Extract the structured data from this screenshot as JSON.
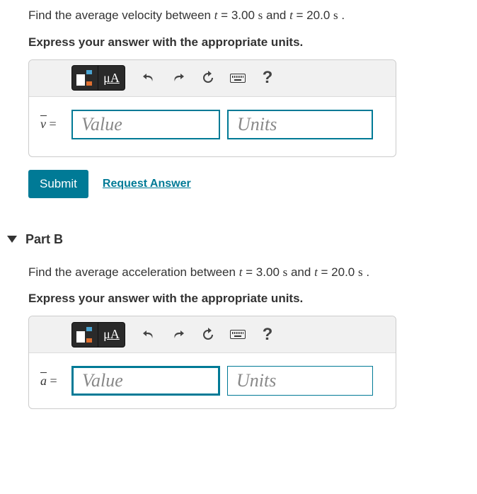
{
  "partA": {
    "prompt_prefix": "Find the average velocity between ",
    "t1_var": "t",
    "t1_eq": " = 3.00 ",
    "t1_unit": "s",
    "mid": " and ",
    "t2_var": "t",
    "t2_eq": " = 20.0 ",
    "t2_unit": "s",
    "suffix": " .",
    "instruction": "Express your answer with the appropriate units.",
    "var_v": "v",
    "var_eq": " = ",
    "value_placeholder": "Value",
    "units_placeholder": "Units",
    "mua_label": "μA",
    "help_label": "?",
    "submit_label": "Submit",
    "request_label": "Request Answer"
  },
  "partB": {
    "title": "Part B",
    "prompt_prefix": "Find the average acceleration between ",
    "t1_var": "t",
    "t1_eq": " = 3.00 ",
    "t1_unit": "s",
    "mid": " and ",
    "t2_var": "t",
    "t2_eq": " = 20.0 ",
    "t2_unit": "s",
    "suffix": " .",
    "instruction": "Express your answer with the appropriate units.",
    "var_a": "a",
    "var_eq": " = ",
    "value_placeholder": "Value",
    "units_placeholder": "Units",
    "mua_label": "μA",
    "help_label": "?"
  }
}
